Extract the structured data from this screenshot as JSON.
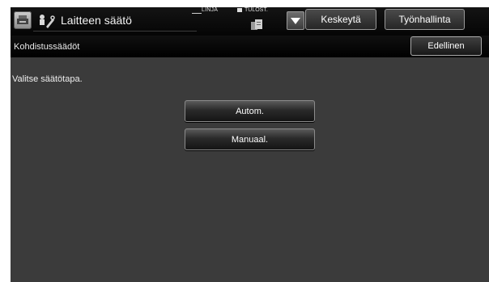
{
  "header": {
    "title": "Laitteen säätö",
    "app_icon": "scanner-copier-icon",
    "mode_icon": "user-tool-icon",
    "linja_label": "LINJA",
    "tulost_label": "TULOST.",
    "printer_icon": "printer-icon",
    "dropdown_icon": "triangle-down-icon",
    "pause_label": "Keskeytä",
    "jobs_label": "Työnhallinta"
  },
  "subheader": {
    "title": "Kohdistussäädöt",
    "back_label": "Edellinen"
  },
  "main": {
    "instruction": "Valitse säätötapa.",
    "options": [
      {
        "label": "Autom."
      },
      {
        "label": "Manuaal."
      }
    ]
  },
  "colors": {
    "background": "#3b3b3b",
    "bar": "#0a0a0a",
    "text": "#ffffff"
  }
}
